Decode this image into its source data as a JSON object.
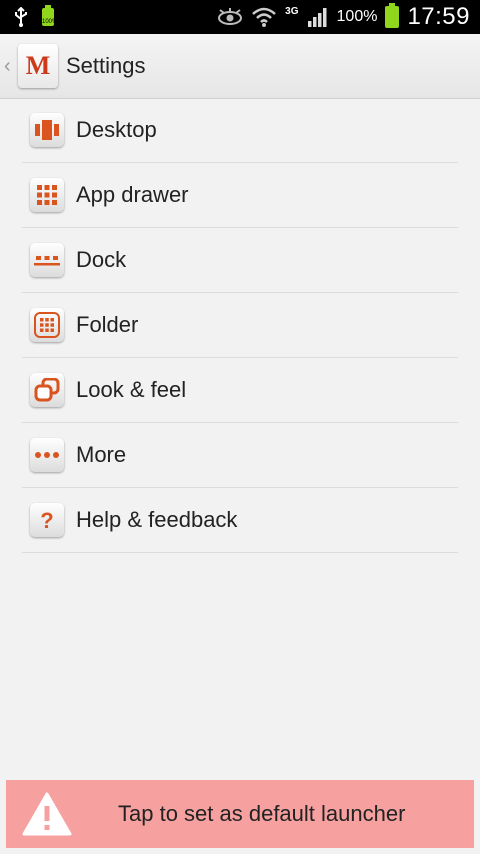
{
  "status_bar": {
    "battery_small_label": "100%",
    "network": "3G",
    "battery_percent": "100%",
    "time": "17:59"
  },
  "action_bar": {
    "back": "‹",
    "logo": "M",
    "title": "Settings"
  },
  "settings_items": [
    {
      "label": "Desktop",
      "icon": "desktop-icon"
    },
    {
      "label": "App drawer",
      "icon": "app-drawer-icon"
    },
    {
      "label": "Dock",
      "icon": "dock-icon"
    },
    {
      "label": "Folder",
      "icon": "folder-icon"
    },
    {
      "label": "Look & feel",
      "icon": "look-feel-icon"
    },
    {
      "label": "More",
      "icon": "more-icon"
    },
    {
      "label": "Help & feedback",
      "icon": "help-icon"
    }
  ],
  "banner": {
    "text": "Tap to set as default launcher"
  },
  "colors": {
    "accent": "#d9541f",
    "banner_bg": "#f6a0a0",
    "battery": "#8fd61c"
  }
}
